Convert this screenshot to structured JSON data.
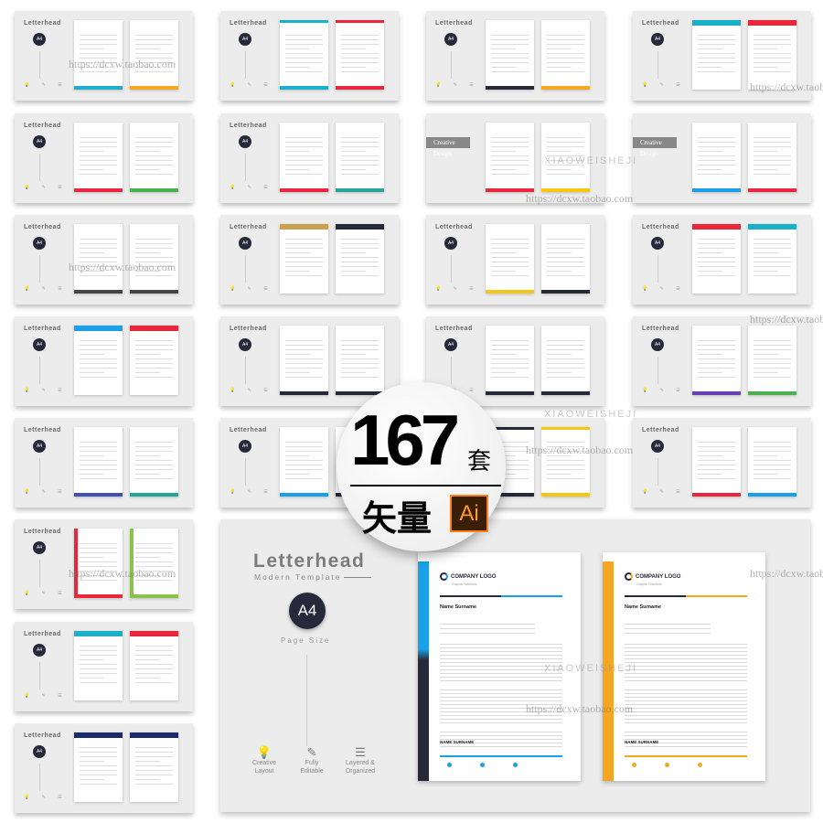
{
  "thumb_label": "Letterhead",
  "thumb_a4": "A4",
  "creative_label": "Creative Design",
  "thumb_icons": "💡 ✎ ☰",
  "thumbnails": [
    {
      "col": 0,
      "row": 0,
      "c1": "#1ab0c8",
      "c2": "#f5a623",
      "pos": "bottom"
    },
    {
      "col": 1,
      "row": 0,
      "c1": "#1ab0c8",
      "c2": "#e8283a",
      "pos": "corner"
    },
    {
      "col": 2,
      "row": 0,
      "c1": "#26293a",
      "c2": "#f5a623",
      "pos": "bottom"
    },
    {
      "col": 3,
      "row": 0,
      "c1": "#1ab0c8",
      "c2": "#e8283a",
      "pos": "top"
    },
    {
      "col": 0,
      "row": 1,
      "c1": "#e8283a",
      "c2": "#4caf50",
      "pos": "bottom"
    },
    {
      "col": 1,
      "row": 1,
      "c1": "#e8283a",
      "c2": "#26a69a",
      "pos": "bottom"
    },
    {
      "col": 2,
      "row": 1,
      "c1": "#e8283a",
      "c2": "#f5c518",
      "pos": "bottom",
      "creative": true
    },
    {
      "col": 3,
      "row": 1,
      "c1": "#1aa0e8",
      "c2": "#e8283a",
      "pos": "bottom",
      "creative": true
    },
    {
      "col": 0,
      "row": 2,
      "c1": "#444444",
      "c2": "#444444",
      "pos": "bottom"
    },
    {
      "col": 1,
      "row": 2,
      "c1": "#c8a050",
      "c2": "#26293a",
      "pos": "top"
    },
    {
      "col": 2,
      "row": 2,
      "c1": "#f5c518",
      "c2": "#26293a",
      "pos": "bottom"
    },
    {
      "col": 3,
      "row": 2,
      "c1": "#e8283a",
      "c2": "#1ab0c8",
      "pos": "top"
    },
    {
      "col": 0,
      "row": 3,
      "c1": "#1aa0e8",
      "c2": "#e8283a",
      "pos": "top"
    },
    {
      "col": 1,
      "row": 3,
      "c1": "#26293a",
      "c2": "#26293a",
      "pos": "bottom"
    },
    {
      "col": 2,
      "row": 3,
      "c1": "#26293a",
      "c2": "#26293a",
      "pos": "bottom"
    },
    {
      "col": 3,
      "row": 3,
      "c1": "#6a3fb5",
      "c2": "#4caf50",
      "pos": "bottom"
    },
    {
      "col": 0,
      "row": 4,
      "c1": "#3f51b5",
      "c2": "#26a69a",
      "pos": "bottom"
    },
    {
      "col": 1,
      "row": 4,
      "c1": "#1aa0e8",
      "c2": "#26293a",
      "pos": "bottom"
    },
    {
      "col": 2,
      "row": 4,
      "c1": "#26293a",
      "c2": "#f5c518",
      "pos": "corner"
    },
    {
      "col": 3,
      "row": 4,
      "c1": "#e8283a",
      "c2": "#1aa0e8",
      "pos": "bottom"
    },
    {
      "col": 0,
      "row": 5,
      "c1": "#e8283a",
      "c2": "#8bc34a",
      "pos": "side"
    },
    {
      "col": 0,
      "row": 6,
      "c1": "#1ab0c8",
      "c2": "#e8283a",
      "pos": "top"
    },
    {
      "col": 0,
      "row": 7,
      "c1": "#1a2a6c",
      "c2": "#1a2a6c",
      "pos": "top"
    }
  ],
  "badge": {
    "count": "167",
    "unit": "套",
    "vector": "矢量",
    "ai": "Ai",
    "ai_color": "#ff7f18"
  },
  "showcase": {
    "title": "Letterhead",
    "subtitle": "Modern Template",
    "size": "A4",
    "size_label": "Page Size",
    "features": [
      {
        "icon": "lightbulb-icon",
        "glyph": "💡",
        "line1": "Creative",
        "line2": "Layout"
      },
      {
        "icon": "edit-icon",
        "glyph": "✎",
        "line1": "Fully",
        "line2": "Editable"
      },
      {
        "icon": "list-icon",
        "glyph": "☰",
        "line1": "Layered &",
        "line2": "Organized"
      }
    ],
    "pages": [
      {
        "accent": "#1aa0e8",
        "company": "COMPANY LOGO",
        "tagline": "Graphic Solutions",
        "name": "Name Surname",
        "signature": "NAME SURNAME"
      },
      {
        "accent": "#f5a623",
        "company": "COMPANY LOGO",
        "tagline": "Graphic Solutions",
        "name": "Name Surname",
        "signature": "NAME SURNAME"
      }
    ],
    "dark": "#26293a"
  },
  "watermarks": {
    "url": "https://dcxw.taobao.com",
    "brand": "XIAOWEISHEJI"
  }
}
